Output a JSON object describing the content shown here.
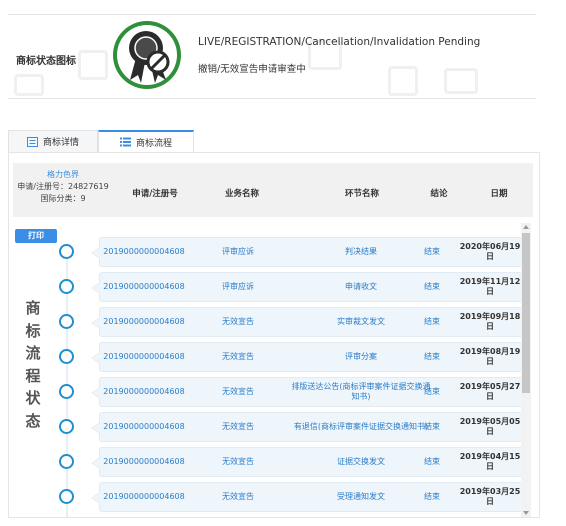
{
  "status": {
    "label": "商标状态图标",
    "text_en": "LIVE/REGISTRATION/Cancellation/Invalidation Pending",
    "text_cn": "撤销/无效宣告申请审查中",
    "badge_icon": "ribbon-award-prohibited-icon",
    "badge_color": "#2f8f3a"
  },
  "tabs": [
    {
      "label": "商标详情",
      "icon": "document-list-icon",
      "active": false
    },
    {
      "label": "商标流程",
      "icon": "list-lines-icon",
      "active": true
    }
  ],
  "mark": {
    "name": "格力色界",
    "reg_number": "申请/注册号：24827619",
    "intl_class": "国际分类：9"
  },
  "table_headers": [
    "申请/注册号",
    "业务名称",
    "环节名称",
    "结论",
    "日期"
  ],
  "print_label": "打印",
  "process_title": "商标流程状态",
  "rows": [
    {
      "reg": "2019000000004608",
      "business": "评审应诉",
      "step": "判决结果",
      "result": "结束",
      "date": "2020年06月19日"
    },
    {
      "reg": "2019000000004608",
      "business": "评审应诉",
      "step": "申请收文",
      "result": "结束",
      "date": "2019年11月12日"
    },
    {
      "reg": "2019000000004608",
      "business": "无效宣告",
      "step": "实审裁文发文",
      "result": "结束",
      "date": "2019年09月18日"
    },
    {
      "reg": "2019000000004608",
      "business": "无效宣告",
      "step": "评审分案",
      "result": "结束",
      "date": "2019年08月19日"
    },
    {
      "reg": "2019000000004608",
      "business": "无效宣告",
      "step": "排版送达公告(商标评审案件证据交换通知书)",
      "result": "结束",
      "date": "2019年05月27日"
    },
    {
      "reg": "2019000000004608",
      "business": "无效宣告",
      "step": "有退信(商标评审案件证据交换通知书)",
      "result": "结束",
      "date": "2019年05月05日"
    },
    {
      "reg": "2019000000004608",
      "business": "无效宣告",
      "step": "证据交换发文",
      "result": "结束",
      "date": "2019年04月15日"
    },
    {
      "reg": "2019000000004608",
      "business": "无效宣告",
      "step": "受理通知发文",
      "result": "结束",
      "date": "2019年03月25日"
    }
  ],
  "colors": {
    "accent": "#3a8ee6",
    "node": "#1f8fd0",
    "row_bg": "#eef5fb",
    "link": "#2a7dc9"
  }
}
